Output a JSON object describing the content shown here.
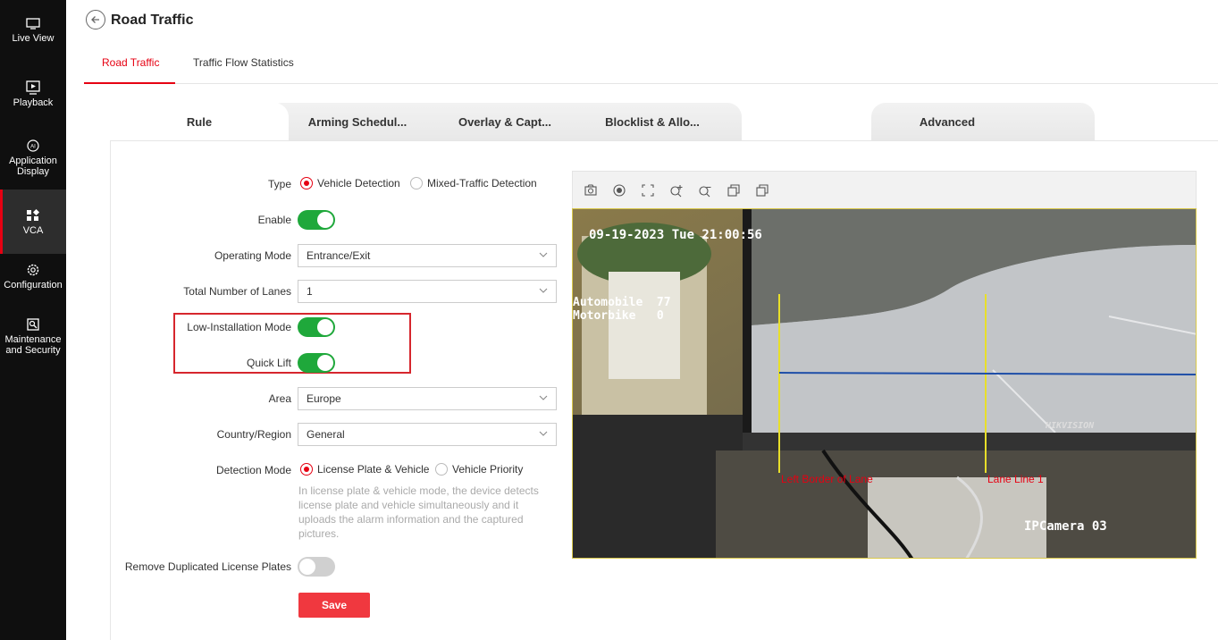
{
  "nav": [
    {
      "label": "Live View",
      "icon": "monitor-icon"
    },
    {
      "label": "Playback",
      "icon": "play-icon"
    },
    {
      "label": "Application\nDisplay",
      "icon": "ai-icon"
    },
    {
      "label": "VCA",
      "icon": "grid-icon"
    },
    {
      "label": "Configuration",
      "icon": "gear-icon"
    },
    {
      "label": "Maintenance\nand Security",
      "icon": "maintenance-icon"
    }
  ],
  "header": {
    "title": "Road Traffic"
  },
  "top_tabs": [
    "Road Traffic",
    "Traffic Flow Statistics"
  ],
  "sub_tabs": [
    "Rule",
    "Arming Schedul...",
    "Overlay & Capt...",
    "Blocklist & Allo...",
    "Advanced"
  ],
  "form": {
    "type": {
      "label": "Type",
      "options": [
        "Vehicle Detection",
        "Mixed-Traffic Detection"
      ],
      "selected": "Vehicle Detection"
    },
    "enable": {
      "label": "Enable",
      "value": true
    },
    "operating_mode": {
      "label": "Operating Mode",
      "value": "Entrance/Exit"
    },
    "total_lanes": {
      "label": "Total Number of Lanes",
      "value": "1"
    },
    "low_installation": {
      "label": "Low-Installation Mode",
      "value": true
    },
    "quick_lift": {
      "label": "Quick Lift",
      "value": true
    },
    "area": {
      "label": "Area",
      "value": "Europe"
    },
    "country": {
      "label": "Country/Region",
      "value": "General"
    },
    "detection_mode": {
      "label": "Detection Mode",
      "options": [
        "License Plate & Vehicle",
        "Vehicle Priority"
      ],
      "selected": "License Plate & Vehicle",
      "hint": "In license plate & vehicle mode, the device detects license plate and vehicle simultaneously and it uploads the alarm information and the captured pictures."
    },
    "remove_duplicates": {
      "label": "Remove Duplicated License Plates",
      "value": false
    },
    "save_label": "Save"
  },
  "video": {
    "toolbar_icons": [
      "camera-icon",
      "record-icon",
      "fullscreen-icon",
      "zoom-in-icon",
      "zoom-out-icon",
      "copy-icon",
      "paste-icon"
    ],
    "timestamp": "09-19-2023 Tue 21:00:56",
    "counts": "Automobile  77\nMotorbike   0",
    "camera_name": "IPCamera 03",
    "monitor_brand": "HIKVISION",
    "lane_labels": [
      "Left Border of Lane",
      "Lane Line 1"
    ]
  },
  "colors": {
    "accent": "#e60012",
    "toggle_on": "#1fa83b",
    "sidebar": "#0f0f0f"
  }
}
